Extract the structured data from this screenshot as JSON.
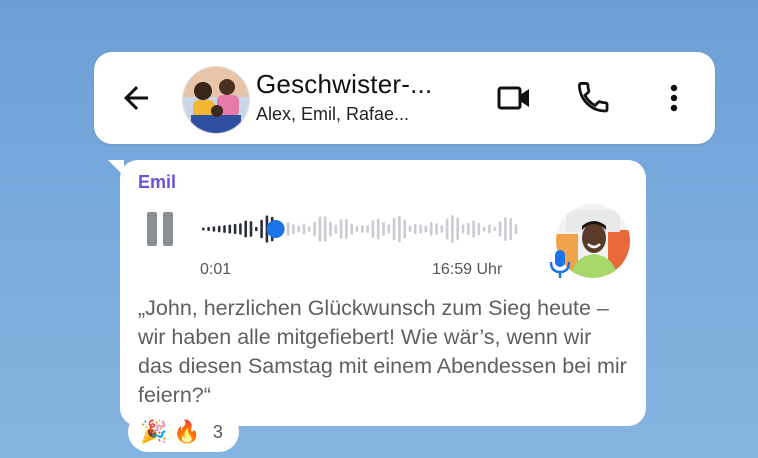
{
  "header": {
    "title": "Geschwister-...",
    "members": "Alex, Emil, Rafae...",
    "icons": [
      "arrow-back-icon",
      "video-call-icon",
      "phone-icon",
      "more-vertical-icon"
    ]
  },
  "message": {
    "sender": "Emil",
    "voice": {
      "elapsed": "0:01",
      "sent_time": "16:59 Uhr",
      "state": "playing",
      "progress": 0.18
    },
    "transcript": "„John, herzlichen Glückwunsch zum Sieg heute – wir haben alle mitgefiebert! Wie wär’s, wenn wir das diesen Samstag mit einem Abendessen bei mir feiern?“",
    "reactions": {
      "emojis": [
        "🎉",
        "🔥"
      ],
      "count": "3"
    }
  },
  "colors": {
    "accent": "#1a73e8",
    "sender_name": "#6b4fd6",
    "background": "#79aadc"
  }
}
